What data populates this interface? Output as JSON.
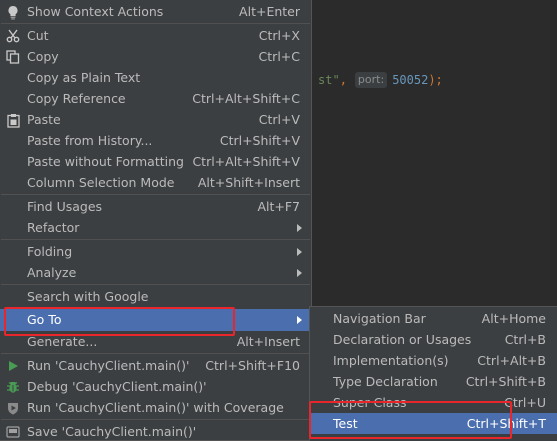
{
  "editor": {
    "code_string_tail": "st\"",
    "code_comma": ",",
    "param_hint": "port:",
    "port_value": "50052",
    "code_end": ");"
  },
  "context_menu": {
    "items": [
      {
        "label": "Show Context Actions",
        "shortcut": "Alt+Enter",
        "icon": "lightbulb-icon"
      },
      {
        "label": "Cut",
        "shortcut": "Ctrl+X",
        "icon": "scissors-icon"
      },
      {
        "label": "Copy",
        "shortcut": "Ctrl+C",
        "icon": "copy-icon"
      },
      {
        "label": "Copy as Plain Text",
        "shortcut": ""
      },
      {
        "label": "Copy Reference",
        "shortcut": "Ctrl+Alt+Shift+C"
      },
      {
        "label": "Paste",
        "shortcut": "Ctrl+V",
        "icon": "paste-icon"
      },
      {
        "label": "Paste from History...",
        "shortcut": "Ctrl+Shift+V"
      },
      {
        "label": "Paste without Formatting",
        "shortcut": "Ctrl+Alt+Shift+V"
      },
      {
        "label": "Column Selection Mode",
        "shortcut": "Alt+Shift+Insert"
      },
      {
        "label": "Find Usages",
        "shortcut": "Alt+F7"
      },
      {
        "label": "Refactor",
        "shortcut": "",
        "submenu": true
      },
      {
        "label": "Folding",
        "shortcut": "",
        "submenu": true
      },
      {
        "label": "Analyze",
        "shortcut": "",
        "submenu": true
      },
      {
        "label": "Search with Google",
        "shortcut": ""
      },
      {
        "label": "Go To",
        "shortcut": "",
        "submenu": true,
        "selected": true
      },
      {
        "label": "Generate...",
        "shortcut": "Alt+Insert"
      },
      {
        "label": "Run 'CauchyClient.main()'",
        "shortcut": "Ctrl+Shift+F10",
        "icon": "run-icon"
      },
      {
        "label": "Debug 'CauchyClient.main()'",
        "shortcut": "",
        "icon": "debug-icon"
      },
      {
        "label": "Run 'CauchyClient.main()' with Coverage",
        "shortcut": "",
        "icon": "coverage-icon"
      },
      {
        "label": "Save 'CauchyClient.main()'",
        "shortcut": "",
        "icon": "save-icon"
      }
    ]
  },
  "goto_submenu": {
    "items": [
      {
        "label": "Navigation Bar",
        "shortcut": "Alt+Home"
      },
      {
        "label": "Declaration or Usages",
        "shortcut": "Ctrl+B"
      },
      {
        "label": "Implementation(s)",
        "shortcut": "Ctrl+Alt+B"
      },
      {
        "label": "Type Declaration",
        "shortcut": "Ctrl+Shift+B"
      },
      {
        "label": "Super Class",
        "shortcut": "Ctrl+U"
      },
      {
        "label": "Test",
        "shortcut": "Ctrl+Shift+T",
        "selected": true
      }
    ]
  },
  "colors": {
    "menu_bg": "#3c3f41",
    "selection": "#4b6eaf",
    "annotation_red": "#e8262b",
    "run_green": "#499c54"
  }
}
